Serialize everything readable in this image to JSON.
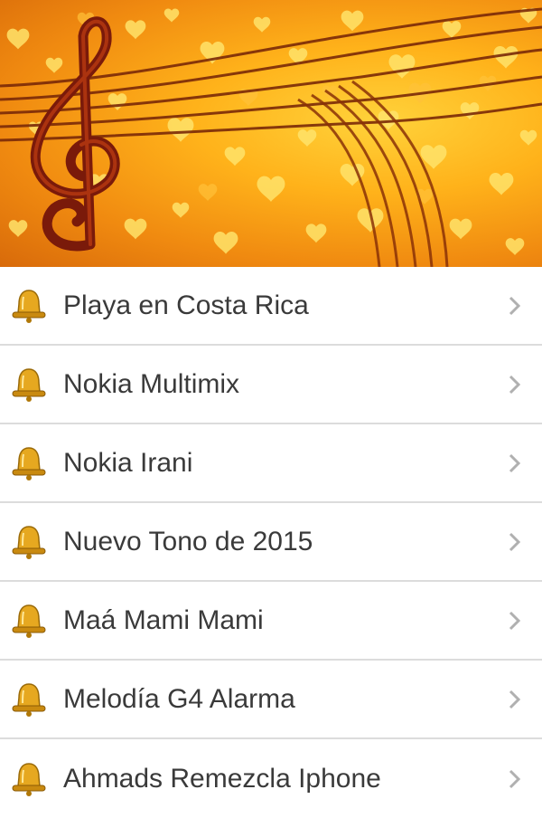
{
  "ringtones": [
    {
      "label": "Playa en Costa Rica"
    },
    {
      "label": "Nokia Multimix"
    },
    {
      "label": "Nokia Irani"
    },
    {
      "label": "Nuevo Tono de 2015"
    },
    {
      "label": "Maá Mami Mami"
    },
    {
      "label": "Melodía G4 Alarma"
    },
    {
      "label": "Ahmads Remezcla Iphone"
    }
  ],
  "icons": {
    "item_icon": "bell-icon",
    "item_arrow": "chevron-right-icon",
    "banner": "treble-clef-music-staff-hearts"
  },
  "colors": {
    "banner_orange": "#f5a014",
    "bell_gold": "#e0a020",
    "text": "#3a3a3a",
    "divider": "#dcdcdc"
  }
}
